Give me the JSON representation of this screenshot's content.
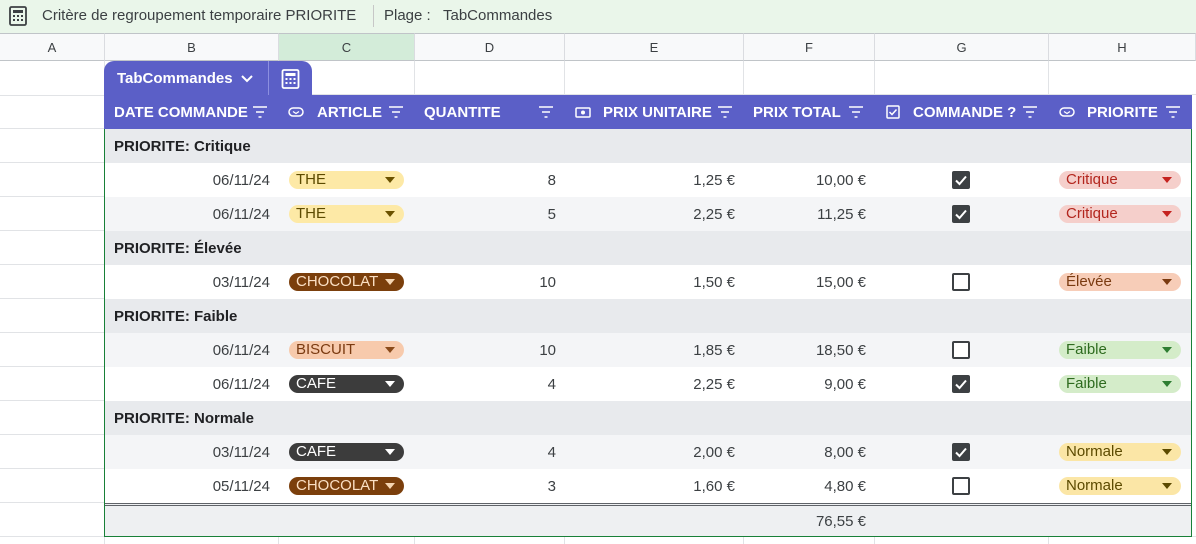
{
  "topbar": {
    "icon": "calculator-icon",
    "title": "Critère de regroupement temporaire PRIORITE",
    "range_label": "Plage :",
    "range_value": "TabCommandes"
  },
  "columns": [
    "A",
    "B",
    "C",
    "D",
    "E",
    "F",
    "G",
    "H"
  ],
  "table": {
    "name": "TabCommandes",
    "headers": {
      "date": "DATE COMMANDE",
      "article": "ARTICLE",
      "quantite": "QUANTITE",
      "prix_unitaire": "PRIX UNITAIRE",
      "prix_total": "PRIX TOTAL",
      "commande": "COMMANDE ?",
      "priorite": "PRIORITE"
    },
    "groups": [
      {
        "label": "PRIORITE: Critique",
        "rows": [
          {
            "date": "06/11/24",
            "article": "THE",
            "quantite": "8",
            "prix_unitaire": "1,25 €",
            "prix_total": "10,00 €",
            "commande": true,
            "priorite": "Critique"
          },
          {
            "date": "06/11/24",
            "article": "THE",
            "quantite": "5",
            "prix_unitaire": "2,25 €",
            "prix_total": "11,25 €",
            "commande": true,
            "priorite": "Critique"
          }
        ]
      },
      {
        "label": "PRIORITE: Élevée",
        "rows": [
          {
            "date": "03/11/24",
            "article": "CHOCOLAT",
            "quantite": "10",
            "prix_unitaire": "1,50 €",
            "prix_total": "15,00 €",
            "commande": false,
            "priorite": "Élevée"
          }
        ]
      },
      {
        "label": "PRIORITE: Faible",
        "rows": [
          {
            "date": "06/11/24",
            "article": "BISCUIT",
            "quantite": "10",
            "prix_unitaire": "1,85 €",
            "prix_total": "18,50 €",
            "commande": false,
            "priorite": "Faible"
          },
          {
            "date": "06/11/24",
            "article": "CAFE",
            "quantite": "4",
            "prix_unitaire": "2,25 €",
            "prix_total": "9,00 €",
            "commande": true,
            "priorite": "Faible"
          }
        ]
      },
      {
        "label": "PRIORITE: Normale",
        "rows": [
          {
            "date": "03/11/24",
            "article": "CAFE",
            "quantite": "4",
            "prix_unitaire": "2,00 €",
            "prix_total": "8,00 €",
            "commande": true,
            "priorite": "Normale"
          },
          {
            "date": "05/11/24",
            "article": "CHOCOLAT",
            "quantite": "3",
            "prix_unitaire": "1,60 €",
            "prix_total": "4,80 €",
            "commande": false,
            "priorite": "Normale"
          }
        ]
      }
    ],
    "total": "76,55 €"
  },
  "colors": {
    "header": "#5b5fc7",
    "article": {
      "THE": {
        "bg": "#fde9a6",
        "fg": "#5c4a00",
        "tri": "#6b5200"
      },
      "CHOCOLAT": {
        "bg": "#7b3f0c",
        "fg": "#fbe0c4",
        "tri": "#f6d6b3"
      },
      "BISCUIT": {
        "bg": "#f7caac",
        "fg": "#7a3a10",
        "tri": "#8a4a1a"
      },
      "CAFE": {
        "bg": "#3c3c3c",
        "fg": "#ffffff",
        "tri": "#ffffff"
      }
    },
    "priorite": {
      "Critique": {
        "bg": "#f5cfcb",
        "fg": "#b3261e",
        "tri": "#c5221f"
      },
      "Élevée": {
        "bg": "#f7cdb8",
        "fg": "#7a3a10",
        "tri": "#7a3a10"
      },
      "Faible": {
        "bg": "#d4ecc9",
        "fg": "#2e6b1f",
        "tri": "#2e7d32"
      },
      "Normale": {
        "bg": "#fbe6a6",
        "fg": "#5c4a00",
        "tri": "#5c4a00"
      }
    }
  }
}
